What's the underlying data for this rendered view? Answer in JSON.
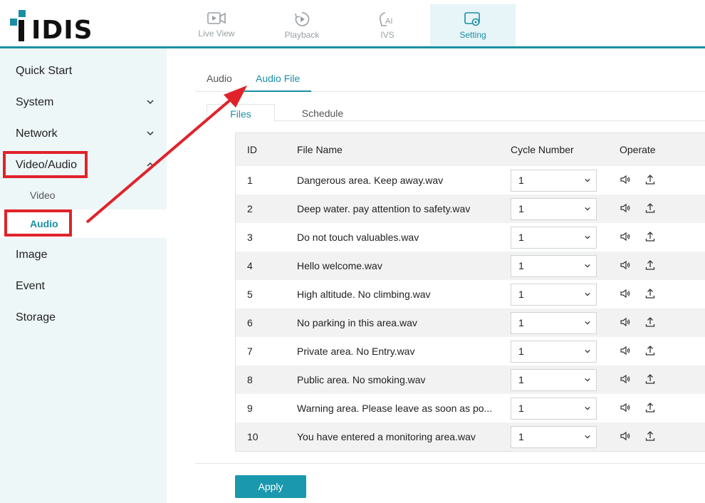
{
  "brand": {
    "logo_text": "IDIS"
  },
  "top_nav": [
    {
      "label": "Live View",
      "icon": "video-icon"
    },
    {
      "label": "Playback",
      "icon": "playback-icon"
    },
    {
      "label": "IVS",
      "icon": "ai-icon"
    },
    {
      "label": "Setting",
      "icon": "setting-icon",
      "active": true
    }
  ],
  "sidebar": {
    "items": [
      {
        "label": "Quick Start"
      },
      {
        "label": "System",
        "chevron": "⌄"
      },
      {
        "label": "Network",
        "chevron": "⌄"
      },
      {
        "label": "Video/Audio",
        "chevron": "⌃"
      }
    ],
    "sub_items": [
      {
        "label": "Video"
      },
      {
        "label": "Audio",
        "active": true
      }
    ],
    "items_after": [
      {
        "label": "Image"
      },
      {
        "label": "Event"
      },
      {
        "label": "Storage"
      }
    ]
  },
  "tabs": [
    {
      "label": "Audio"
    },
    {
      "label": "Audio File",
      "active": true
    }
  ],
  "subtabs": [
    {
      "label": "Files",
      "active": true
    },
    {
      "label": "Schedule"
    }
  ],
  "table": {
    "headers": {
      "id": "ID",
      "file_name": "File Name",
      "cycle": "Cycle Number",
      "operate": "Operate"
    },
    "rows": [
      {
        "id": "1",
        "file": "Dangerous area. Keep away.wav",
        "cycle": "1"
      },
      {
        "id": "2",
        "file": "Deep water. pay attention to safety.wav",
        "cycle": "1"
      },
      {
        "id": "3",
        "file": "Do not touch valuables.wav",
        "cycle": "1"
      },
      {
        "id": "4",
        "file": "Hello welcome.wav",
        "cycle": "1"
      },
      {
        "id": "5",
        "file": "High altitude. No climbing.wav",
        "cycle": "1"
      },
      {
        "id": "6",
        "file": "No parking in this area.wav",
        "cycle": "1"
      },
      {
        "id": "7",
        "file": "Private area. No Entry.wav",
        "cycle": "1"
      },
      {
        "id": "8",
        "file": "Public area. No smoking.wav",
        "cycle": "1"
      },
      {
        "id": "9",
        "file": "Warning area. Please leave as soon as po...",
        "cycle": "1"
      },
      {
        "id": "10",
        "file": "You have entered a monitoring area.wav",
        "cycle": "1"
      }
    ]
  },
  "apply_label": "Apply",
  "colors": {
    "accent": "#1a8fa3",
    "highlight": "#e0232a",
    "sidebar_bg": "#eef7f8"
  }
}
